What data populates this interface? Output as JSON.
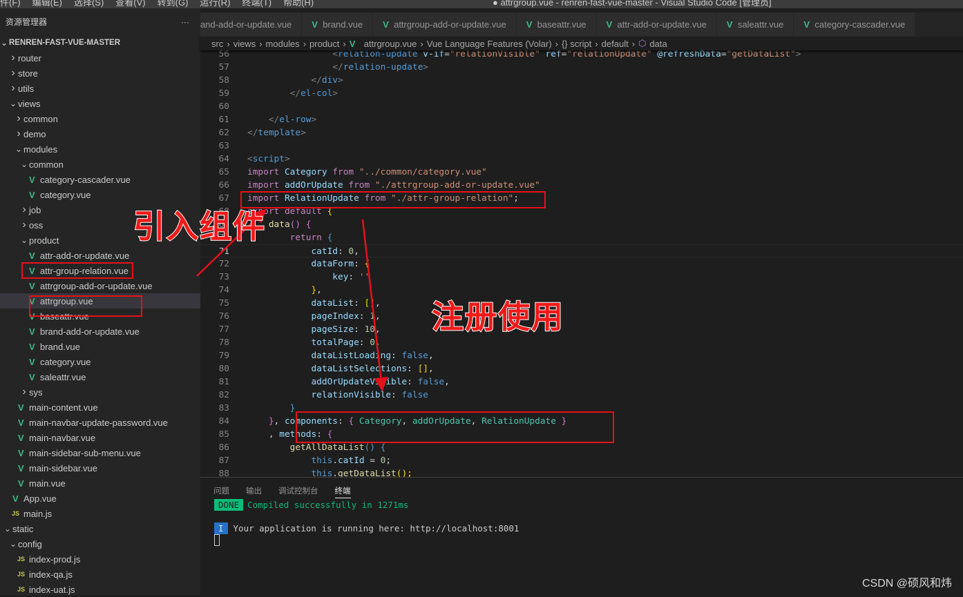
{
  "menubar": {
    "items": [
      "件(F)",
      "编辑(E)",
      "选择(S)",
      "查看(V)",
      "转到(G)",
      "运行(R)",
      "终端(T)",
      "帮助(H)"
    ],
    "title": "● attrgroup.vue - renren-fast-vue-master - Visual Studio Code [管理员]"
  },
  "sidebar": {
    "title": "资源管理器",
    "more": "···",
    "root": "RENREN-FAST-VUE-MASTER",
    "items": [
      {
        "label": "router",
        "depth": 1,
        "type": "folder-closed"
      },
      {
        "label": "store",
        "depth": 1,
        "type": "folder-closed"
      },
      {
        "label": "utils",
        "depth": 1,
        "type": "folder-closed"
      },
      {
        "label": "views",
        "depth": 1,
        "type": "folder-open"
      },
      {
        "label": "common",
        "depth": 2,
        "type": "folder-closed"
      },
      {
        "label": "demo",
        "depth": 2,
        "type": "folder-closed"
      },
      {
        "label": "modules",
        "depth": 2,
        "type": "folder-open"
      },
      {
        "label": "common",
        "depth": 3,
        "type": "folder-open"
      },
      {
        "label": "category-cascader.vue",
        "depth": 4,
        "type": "vue"
      },
      {
        "label": "category.vue",
        "depth": 4,
        "type": "vue"
      },
      {
        "label": "job",
        "depth": 3,
        "type": "folder-closed"
      },
      {
        "label": "oss",
        "depth": 3,
        "type": "folder-closed"
      },
      {
        "label": "product",
        "depth": 3,
        "type": "folder-open"
      },
      {
        "label": "attr-add-or-update.vue",
        "depth": 4,
        "type": "vue"
      },
      {
        "label": "attr-group-relation.vue",
        "depth": 4,
        "type": "vue"
      },
      {
        "label": "attrgroup-add-or-update.vue",
        "depth": 4,
        "type": "vue"
      },
      {
        "label": "attrgroup.vue",
        "depth": 4,
        "type": "vue",
        "selected": true
      },
      {
        "label": "baseattr.vue",
        "depth": 4,
        "type": "vue"
      },
      {
        "label": "brand-add-or-update.vue",
        "depth": 4,
        "type": "vue"
      },
      {
        "label": "brand.vue",
        "depth": 4,
        "type": "vue"
      },
      {
        "label": "category.vue",
        "depth": 4,
        "type": "vue"
      },
      {
        "label": "saleattr.vue",
        "depth": 4,
        "type": "vue"
      },
      {
        "label": "sys",
        "depth": 3,
        "type": "folder-closed"
      },
      {
        "label": "main-content.vue",
        "depth": 2,
        "type": "vue"
      },
      {
        "label": "main-navbar-update-password.vue",
        "depth": 2,
        "type": "vue"
      },
      {
        "label": "main-navbar.vue",
        "depth": 2,
        "type": "vue"
      },
      {
        "label": "main-sidebar-sub-menu.vue",
        "depth": 2,
        "type": "vue"
      },
      {
        "label": "main-sidebar.vue",
        "depth": 2,
        "type": "vue"
      },
      {
        "label": "main.vue",
        "depth": 2,
        "type": "vue"
      },
      {
        "label": "App.vue",
        "depth": 1,
        "type": "vue"
      },
      {
        "label": "main.js",
        "depth": 1,
        "type": "js"
      },
      {
        "label": "static",
        "depth": 0,
        "type": "folder-open"
      },
      {
        "label": "config",
        "depth": 1,
        "type": "folder-open"
      },
      {
        "label": "index-prod.js",
        "depth": 2,
        "type": "js"
      },
      {
        "label": "index-qa.js",
        "depth": 2,
        "type": "js"
      },
      {
        "label": "index-uat.js",
        "depth": 2,
        "type": "js"
      }
    ]
  },
  "tabs": [
    {
      "label": "and-add-or-update.vue",
      "icon": false
    },
    {
      "label": "brand.vue",
      "icon": true
    },
    {
      "label": "attrgroup-add-or-update.vue",
      "icon": true
    },
    {
      "label": "baseattr.vue",
      "icon": true
    },
    {
      "label": "attr-add-or-update.vue",
      "icon": true
    },
    {
      "label": "saleattr.vue",
      "icon": true
    },
    {
      "label": "category-cascader.vue",
      "icon": true
    }
  ],
  "breadcrumb": [
    "src",
    "views",
    "modules",
    "product",
    "attrgroup.vue",
    "Vue Language Features (Volar)",
    "{} script",
    "default",
    "data"
  ],
  "editor": {
    "current_line": 71,
    "lines": [
      {
        "n": 56,
        "i": 16,
        "t": [
          [
            "<",
            "g"
          ],
          [
            "relation-update",
            "t"
          ],
          [
            " v-if",
            "a"
          ],
          [
            "=",
            "p"
          ],
          [
            "\"relationVisible\"",
            "s"
          ],
          [
            " ref",
            "a"
          ],
          [
            "=",
            "p"
          ],
          [
            "\"relationUpdate\"",
            "s"
          ],
          [
            " @refreshData",
            "a"
          ],
          [
            "=",
            "p"
          ],
          [
            "\"getDataList\"",
            "s"
          ],
          [
            ">",
            "g"
          ]
        ]
      },
      {
        "n": 57,
        "i": 16,
        "t": [
          [
            "</",
            "g"
          ],
          [
            "relation-update",
            "t"
          ],
          [
            ">",
            "g"
          ]
        ]
      },
      {
        "n": 58,
        "i": 12,
        "t": [
          [
            "</",
            "g"
          ],
          [
            "div",
            "t"
          ],
          [
            ">",
            "g"
          ]
        ]
      },
      {
        "n": 59,
        "i": 8,
        "t": [
          [
            "</",
            "g"
          ],
          [
            "el-col",
            "t"
          ],
          [
            ">",
            "g"
          ]
        ]
      },
      {
        "n": 60,
        "i": 0,
        "t": []
      },
      {
        "n": 61,
        "i": 4,
        "t": [
          [
            "</",
            "g"
          ],
          [
            "el-row",
            "t"
          ],
          [
            ">",
            "g"
          ]
        ]
      },
      {
        "n": 62,
        "i": 0,
        "t": [
          [
            "</",
            "g"
          ],
          [
            "template",
            "t"
          ],
          [
            ">",
            "g"
          ]
        ]
      },
      {
        "n": 63,
        "i": 0,
        "t": []
      },
      {
        "n": 64,
        "i": 0,
        "t": [
          [
            "<",
            "g"
          ],
          [
            "script",
            "t"
          ],
          [
            ">",
            "g"
          ]
        ]
      },
      {
        "n": 65,
        "i": 0,
        "t": [
          [
            "import ",
            "k"
          ],
          [
            "Category ",
            "v"
          ],
          [
            "from ",
            "k"
          ],
          [
            "\"../common/category.vue\"",
            "s"
          ]
        ]
      },
      {
        "n": 66,
        "i": 0,
        "t": [
          [
            "import ",
            "k"
          ],
          [
            "addOrUpdate ",
            "v"
          ],
          [
            "from ",
            "k"
          ],
          [
            "\"./attrgroup-add-or-update.vue\"",
            "s"
          ]
        ]
      },
      {
        "n": 67,
        "i": 0,
        "t": [
          [
            "import ",
            "k"
          ],
          [
            "RelationUpdate ",
            "v"
          ],
          [
            "from ",
            "k"
          ],
          [
            "\"./attr-group-relation\"",
            "s"
          ],
          [
            ";",
            "p"
          ]
        ]
      },
      {
        "n": 68,
        "i": 0,
        "t": [
          [
            "export ",
            "k"
          ],
          [
            "default ",
            "k"
          ],
          [
            "{",
            "y"
          ]
        ]
      },
      {
        "n": 69,
        "i": 4,
        "t": [
          [
            "data",
            "f"
          ],
          [
            "() ",
            "m"
          ],
          [
            "{",
            "m"
          ]
        ]
      },
      {
        "n": 70,
        "i": 8,
        "t": [
          [
            "return ",
            "k"
          ],
          [
            "{",
            "b"
          ]
        ]
      },
      {
        "n": 71,
        "i": 12,
        "t": [
          [
            "catId",
            "v"
          ],
          [
            ": ",
            "p"
          ],
          [
            "0",
            "n"
          ],
          [
            ",",
            "p"
          ]
        ]
      },
      {
        "n": 72,
        "i": 12,
        "t": [
          [
            "dataForm",
            "v"
          ],
          [
            ": ",
            "p"
          ],
          [
            "{",
            "y"
          ]
        ]
      },
      {
        "n": 73,
        "i": 16,
        "t": [
          [
            "key",
            "v"
          ],
          [
            ": ",
            "p"
          ],
          [
            "''",
            "s"
          ]
        ]
      },
      {
        "n": 74,
        "i": 12,
        "t": [
          [
            "}",
            "y"
          ],
          [
            ",",
            "p"
          ]
        ]
      },
      {
        "n": 75,
        "i": 12,
        "t": [
          [
            "dataList",
            "v"
          ],
          [
            ": ",
            "p"
          ],
          [
            "[]",
            "y"
          ],
          [
            ",",
            "p"
          ]
        ]
      },
      {
        "n": 76,
        "i": 12,
        "t": [
          [
            "pageIndex",
            "v"
          ],
          [
            ": ",
            "p"
          ],
          [
            "1",
            "n"
          ],
          [
            ",",
            "p"
          ]
        ]
      },
      {
        "n": 77,
        "i": 12,
        "t": [
          [
            "pageSize",
            "v"
          ],
          [
            ": ",
            "p"
          ],
          [
            "10",
            "n"
          ],
          [
            ",",
            "p"
          ]
        ]
      },
      {
        "n": 78,
        "i": 12,
        "t": [
          [
            "totalPage",
            "v"
          ],
          [
            ": ",
            "p"
          ],
          [
            "0",
            "n"
          ],
          [
            ",",
            "p"
          ]
        ]
      },
      {
        "n": 79,
        "i": 12,
        "t": [
          [
            "dataListLoading",
            "v"
          ],
          [
            ": ",
            "p"
          ],
          [
            "false",
            "b"
          ],
          [
            ",",
            "p"
          ]
        ]
      },
      {
        "n": 80,
        "i": 12,
        "t": [
          [
            "dataListSelections",
            "v"
          ],
          [
            ": ",
            "p"
          ],
          [
            "[]",
            "y"
          ],
          [
            ",",
            "p"
          ]
        ]
      },
      {
        "n": 81,
        "i": 12,
        "t": [
          [
            "addOrUpdateVisible",
            "v"
          ],
          [
            ": ",
            "p"
          ],
          [
            "false",
            "b"
          ],
          [
            ",",
            "p"
          ]
        ]
      },
      {
        "n": 82,
        "i": 12,
        "t": [
          [
            "relationVisible",
            "v"
          ],
          [
            ": ",
            "p"
          ],
          [
            "false",
            "b"
          ]
        ]
      },
      {
        "n": 83,
        "i": 8,
        "t": [
          [
            "}",
            "b"
          ]
        ]
      },
      {
        "n": 84,
        "i": 4,
        "t": [
          [
            "}",
            "m"
          ],
          [
            ", ",
            "p"
          ],
          [
            "components",
            "v"
          ],
          [
            ": ",
            "p"
          ],
          [
            "{ ",
            "m"
          ],
          [
            "Category",
            "c"
          ],
          [
            ", ",
            "p"
          ],
          [
            "addOrUpdate",
            "c"
          ],
          [
            ", ",
            "p"
          ],
          [
            "RelationUpdate",
            "c"
          ],
          [
            " }",
            "m"
          ]
        ]
      },
      {
        "n": 85,
        "i": 4,
        "t": [
          [
            ", ",
            "p"
          ],
          [
            "methods",
            "v"
          ],
          [
            ": ",
            "p"
          ],
          [
            "{",
            "m"
          ]
        ]
      },
      {
        "n": 86,
        "i": 8,
        "t": [
          [
            "getAllDataList",
            "f"
          ],
          [
            "() ",
            "b"
          ],
          [
            "{",
            "b"
          ]
        ]
      },
      {
        "n": 87,
        "i": 12,
        "t": [
          [
            "this",
            "b"
          ],
          [
            ".",
            "p"
          ],
          [
            "catId",
            "v"
          ],
          [
            " = ",
            "p"
          ],
          [
            "0",
            "n"
          ],
          [
            ";",
            "p"
          ]
        ]
      },
      {
        "n": 88,
        "i": 12,
        "t": [
          [
            "this",
            "b"
          ],
          [
            ".",
            "p"
          ],
          [
            "getDataList",
            "f"
          ],
          [
            "();",
            "y"
          ]
        ]
      }
    ]
  },
  "panel": {
    "tabs": [
      "问题",
      "输出",
      "调试控制台",
      "终端"
    ],
    "active": "终端",
    "done_badge": "DONE",
    "done_text": "Compiled successfully in 1271ms",
    "info_badge": "I",
    "info_text": "Your application is running here: http://localhost:8001"
  },
  "annotations": {
    "import_label": "引入组件",
    "register_label": "注册使用",
    "color": "#e8101a"
  },
  "watermark": "CSDN @硕风和炜"
}
